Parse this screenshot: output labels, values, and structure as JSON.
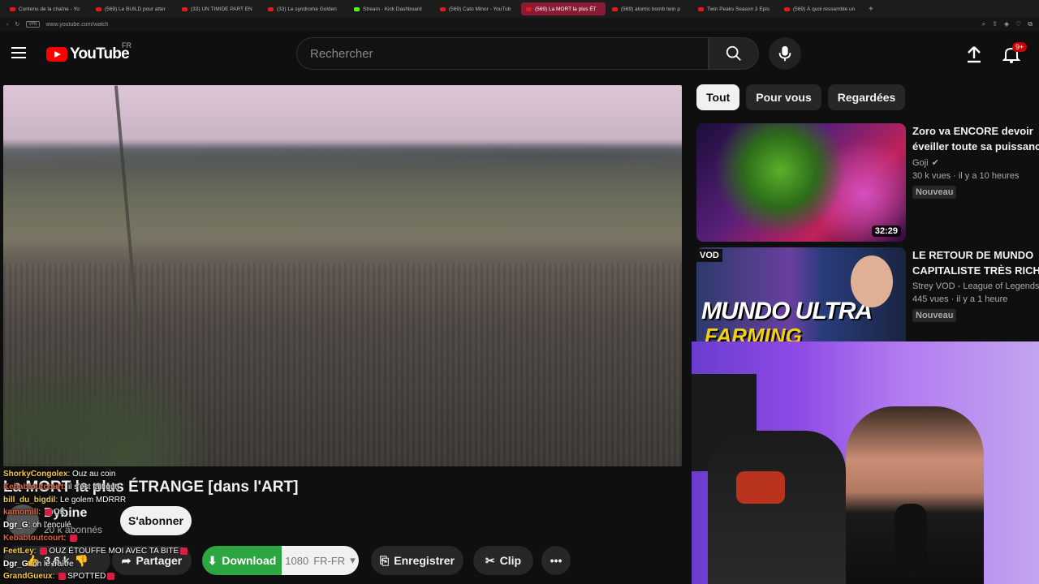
{
  "browser": {
    "tabs": [
      {
        "label": "Contenu de la chaîne - Yo",
        "icon": "youtube-icon",
        "active": false
      },
      {
        "label": "(569) Le BUILD pour atter",
        "icon": "youtube-icon",
        "active": false
      },
      {
        "label": "(33) UN TIMIDE PART EN",
        "icon": "youtube-icon",
        "active": false
      },
      {
        "label": "(33) Le syndrome Golden",
        "icon": "youtube-icon",
        "active": false
      },
      {
        "label": "Stream - Kick Dashboard",
        "icon": "kick-icon",
        "active": false
      },
      {
        "label": "(569) Cato Minor - YouTub",
        "icon": "youtube-icon",
        "active": false
      },
      {
        "label": "(569) La MORT la plus ÉT",
        "icon": "youtube-icon",
        "active": true
      },
      {
        "label": "(569) atomic bomb twin p",
        "icon": "youtube-icon",
        "active": false
      },
      {
        "label": "Twin Peaks Season 3 Epis",
        "icon": "youtube-icon",
        "active": false
      },
      {
        "label": "(569) À quoi ressemble un",
        "icon": "youtube-icon",
        "active": false
      }
    ],
    "new_tab": "+",
    "vpn_label": "VPN",
    "url": "www.youtube.com/watch"
  },
  "header": {
    "logo_text": "YouTube",
    "country_code": "FR",
    "search_placeholder": "Rechercher",
    "notif_count": "9+"
  },
  "video": {
    "title": "La MORT la plus ÉTRANGE [dans l'ART]",
    "channel": "Dybine",
    "subscribers": "20 k abonnés",
    "subscribe_label": "S'abonner",
    "likes": "3,6 k",
    "share_label": "Partager",
    "download_label": "Download",
    "quality_label": "1080",
    "language_label": "FR-FR",
    "save_label": "Enregistrer",
    "clip_label": "Clip"
  },
  "chat": [
    {
      "user": "ShorkyCongolex",
      "color": "#f2c94c",
      "text": "Ouz au coin",
      "emote": false
    },
    {
      "user": "Kebabtoutcourt",
      "color": "#e0623a",
      "text": "il s'est fait gutt",
      "emote": false
    },
    {
      "user": "bill_du_bigdil",
      "color": "#f2c94c",
      "text": "Le golem MDRRR",
      "emote": false
    },
    {
      "user": "kamomill",
      "color": "#e0623a",
      "text": "OK",
      "emote": true
    },
    {
      "user": "Dgr_G",
      "color": "#fff",
      "text": "oh l'enculé",
      "emote": false
    },
    {
      "user": "Kebabtoutcourt",
      "color": "#e0623a",
      "text": "",
      "emote": true
    },
    {
      "user": "FeetLey",
      "color": "#f2c94c",
      "text": "OUZ ÉTOUFFE MOI AVEC TA BITE",
      "emote": true
    },
    {
      "user": "Dgr_G",
      "color": "#fff",
      "text": "oh le traître",
      "emote": false
    },
    {
      "user": "GrandGueux",
      "color": "#f2c94c",
      "text": "SPOTTED",
      "emote": true
    }
  ],
  "chips": [
    {
      "label": "Tout",
      "selected": true
    },
    {
      "label": "Pour vous",
      "selected": false
    },
    {
      "label": "Regardées",
      "selected": false
    }
  ],
  "recommendations": [
    {
      "title_line1": "Zoro va ENCORE devoir",
      "title_line2": "éveiller toute sa puissance",
      "channel": "Goji",
      "verified": true,
      "stats": "30 k vues · il y a 10 heures",
      "badge": "Nouveau",
      "duration": "32:29"
    },
    {
      "title_line1": "LE RETOUR DE MUNDO",
      "title_line2": "CAPITALISTE TRÈS RICHE",
      "channel": "Strey VOD - League of Legends",
      "verified": false,
      "stats": "445 vues · il y a 1 heure",
      "badge": "Nouveau",
      "thumb_tag": "VOD",
      "thumb_text_1": "MUNDO ULTRA",
      "thumb_text_2": "FARMING"
    }
  ],
  "colors": {
    "youtube_red": "#ff0000",
    "download_green": "#2ba640",
    "background": "#0f0f0f"
  }
}
